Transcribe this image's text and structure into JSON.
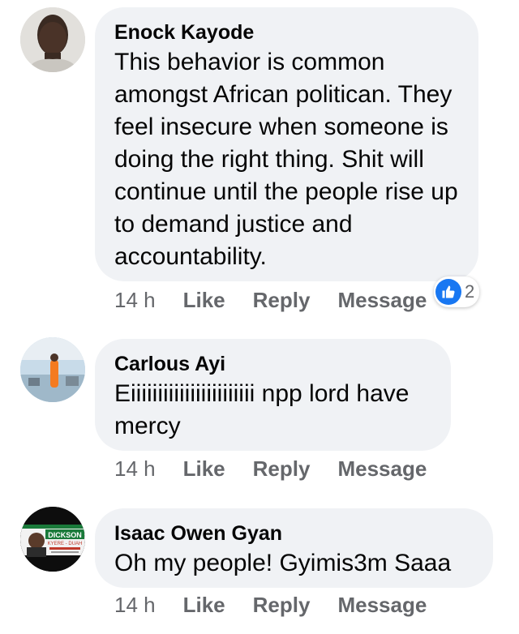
{
  "comments": [
    {
      "author": "Enock Kayode",
      "text": "This behavior is common amongst African politican. They feel insecure when someone is doing the right thing. Shit will continue until the people rise up to demand justice and accountability.",
      "time": "14 h",
      "actions": [
        "Like",
        "Reply",
        "Message"
      ],
      "reactions": {
        "icon": "like-icon",
        "count": "2"
      }
    },
    {
      "author": "Carlous Ayi",
      "text": "Eiiiiiiiiiiiiiiiiiiiiiii npp lord have mercy",
      "time": "14 h",
      "actions": [
        "Like",
        "Reply",
        "Message"
      ]
    },
    {
      "author": "Isaac Owen Gyan",
      "text": "Oh my people! Gyimis3m Saaa",
      "avatar_text": [
        "DICKSON",
        "KYERE - DUAH"
      ],
      "time": "14 h",
      "actions": [
        "Like",
        "Reply",
        "Message"
      ]
    }
  ],
  "colors": {
    "bubble": "#f0f2f5",
    "meta_text": "#65676b",
    "like_blue": "#1877f2"
  }
}
